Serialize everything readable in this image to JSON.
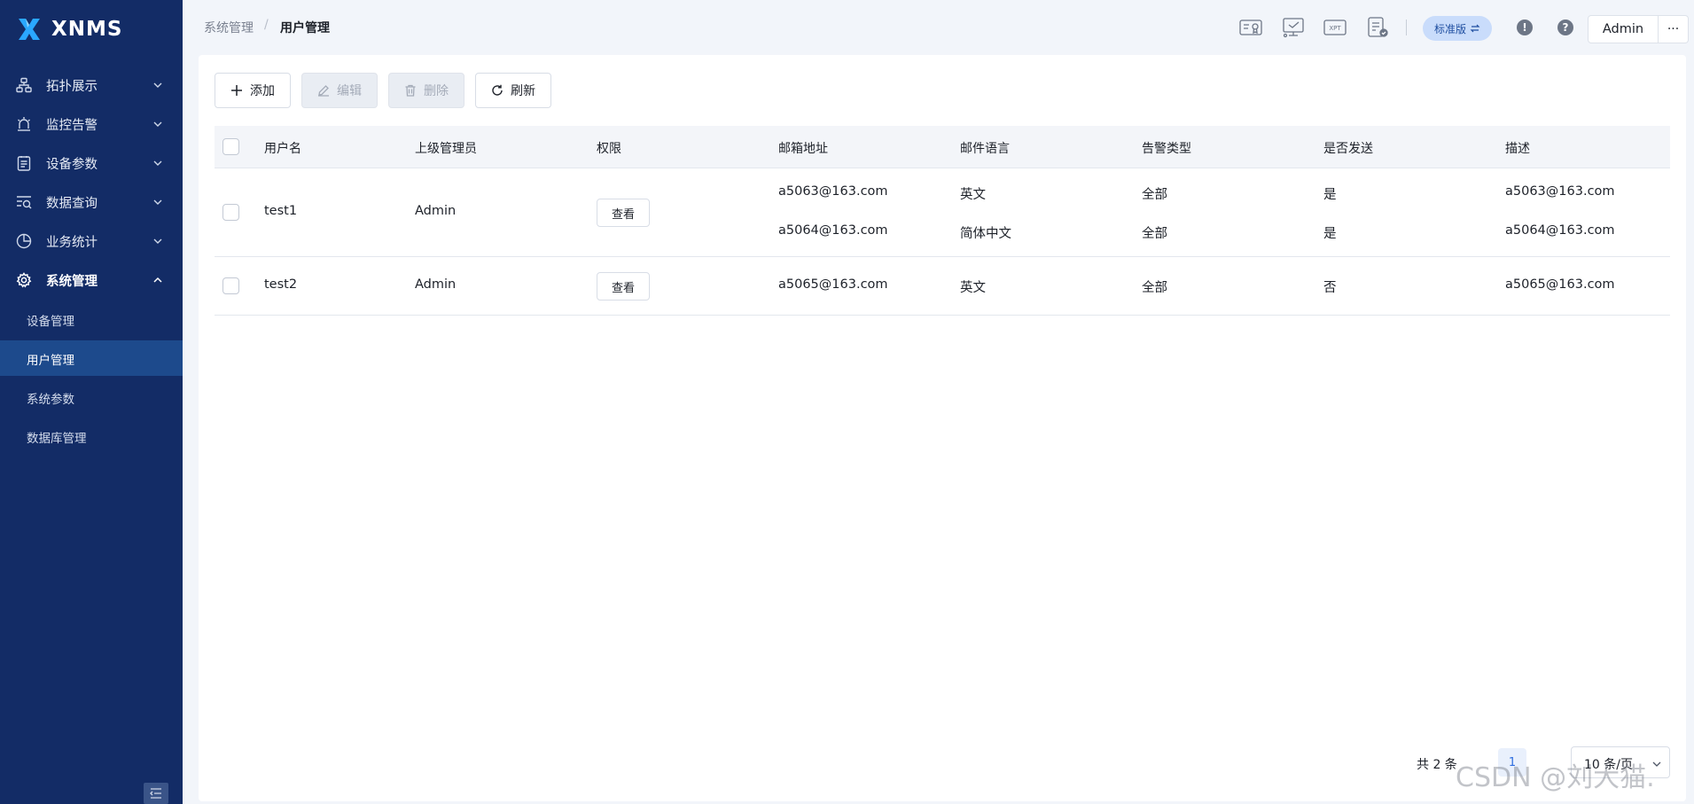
{
  "app": {
    "name": "XNMS"
  },
  "sidebar": {
    "items": [
      {
        "label": "拓扑展示",
        "icon": "topology-icon"
      },
      {
        "label": "监控告警",
        "icon": "alarm-icon"
      },
      {
        "label": "设备参数",
        "icon": "clipboard-icon"
      },
      {
        "label": "数据查询",
        "icon": "data-search-icon"
      },
      {
        "label": "业务统计",
        "icon": "pie-chart-icon"
      },
      {
        "label": "系统管理",
        "icon": "gear-icon"
      }
    ],
    "sub_items": [
      {
        "label": "设备管理"
      },
      {
        "label": "用户管理"
      },
      {
        "label": "系统参数"
      },
      {
        "label": "数据库管理"
      }
    ]
  },
  "header": {
    "breadcrumb": [
      "系统管理",
      "用户管理"
    ],
    "edition": "标准版",
    "user": "Admin",
    "more": "···",
    "icons": [
      "certificate-icon",
      "monitor-check-icon",
      "xpt-icon",
      "report-check-icon",
      "alert-icon",
      "help-icon"
    ]
  },
  "toolbar": {
    "add": "添加",
    "edit": "编辑",
    "delete": "删除",
    "refresh": "刷新"
  },
  "table": {
    "columns": [
      "用户名",
      "上级管理员",
      "权限",
      "邮箱地址",
      "邮件语言",
      "告警类型",
      "是否发送",
      "描述"
    ],
    "rows": [
      {
        "username": "test1",
        "admin": "Admin",
        "permission": "查看",
        "emails": [
          {
            "address": "a5063@163.com",
            "language": "英文",
            "alarm_type": "全部",
            "send": "是",
            "desc": "a5063@163.com"
          },
          {
            "address": "a5064@163.com",
            "language": "简体中文",
            "alarm_type": "全部",
            "send": "是",
            "desc": "a5064@163.com"
          }
        ]
      },
      {
        "username": "test2",
        "admin": "Admin",
        "permission": "查看",
        "emails": [
          {
            "address": "a5065@163.com",
            "language": "英文",
            "alarm_type": "全部",
            "send": "否",
            "desc": "a5065@163.com"
          }
        ]
      }
    ]
  },
  "pagination": {
    "total": "共 2 条",
    "current_page": "1",
    "page_size": "10 条/页"
  },
  "watermark": "CSDN @刘大猫.",
  "colors": {
    "sidebar_bg": "#132c66",
    "sidebar_active": "#1d4a8c",
    "accent": "#2f6ee0"
  }
}
